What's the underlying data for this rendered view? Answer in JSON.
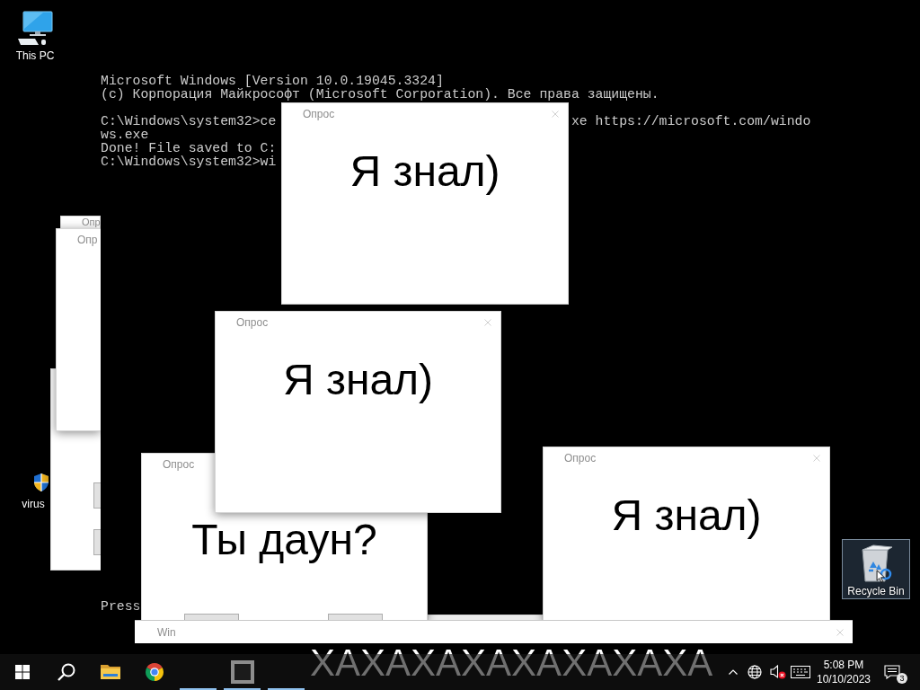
{
  "desktop_icons": [
    {
      "label": "This PC",
      "kind": "computer",
      "selected": false
    },
    {
      "label": "virus",
      "kind": "shield",
      "selected": false
    },
    {
      "label": "Recycle Bin",
      "kind": "recycle_bin",
      "selected": true
    }
  ],
  "console": {
    "lines": [
      {
        "segments": [
          "Microsoft Windows [Version 10.0.19045.3324]"
        ]
      },
      {
        "segments": [
          "(c) Корпорация Майкрософт (Microsoft Corporation). Все права защищены."
        ]
      },
      {
        "gap_before": true,
        "segments": [
          "C:\\Windows\\system32>ce",
          "xe https://microsoft.com/windo"
        ]
      },
      {
        "segments": [
          "ws.exe"
        ]
      },
      {
        "segments": [
          "Done! File saved to C:"
        ]
      },
      {
        "segments": [
          "C:\\Windows\\system32>wi"
        ]
      }
    ],
    "footer": "Press"
  },
  "windows": [
    {
      "kind": "dialog",
      "title": "Опр"
    },
    {
      "kind": "dialog",
      "buttons": [
        {
          "kind": "blank"
        },
        {
          "kind": "blank"
        }
      ]
    },
    {
      "kind": "dialog",
      "title": "Опр"
    },
    {
      "kind": "dialog",
      "title": "Опрос",
      "message": "Я знал)",
      "close_button": true
    },
    {
      "kind": "dialog"
    },
    {
      "kind": "dialog",
      "title": "Опрос",
      "message": "Ты даун?",
      "buttons": [
        {
          "kind": "blank"
        },
        {
          "kind": "blank"
        }
      ]
    },
    {
      "kind": "dialog",
      "title": "Опрос",
      "message": "Я знал)",
      "close_button": true
    },
    {
      "kind": "dialog",
      "title": "Опрос",
      "message": "Я знал)",
      "close_button": true
    },
    {
      "kind": "banner",
      "title": "Win",
      "message": "ХАХАХАХАХАХАХАХА",
      "close_button": true
    }
  ],
  "taskbar": {
    "buttons": [
      {
        "kind": "start",
        "running": false
      },
      {
        "kind": "search",
        "running": false
      },
      {
        "kind": "folder",
        "running": false
      },
      {
        "kind": "browser",
        "running": false
      },
      {
        "kind": "blank",
        "running": true
      },
      {
        "kind": "window",
        "running": true
      },
      {
        "kind": "blank",
        "running": true
      }
    ],
    "tray": [
      {
        "kind": "chevron"
      },
      {
        "kind": "globe"
      },
      {
        "kind": "speaker_muted"
      },
      {
        "kind": "keyboard"
      }
    ],
    "time": "5:08 PM",
    "date": "10/10/2023",
    "notification_count": "3"
  }
}
